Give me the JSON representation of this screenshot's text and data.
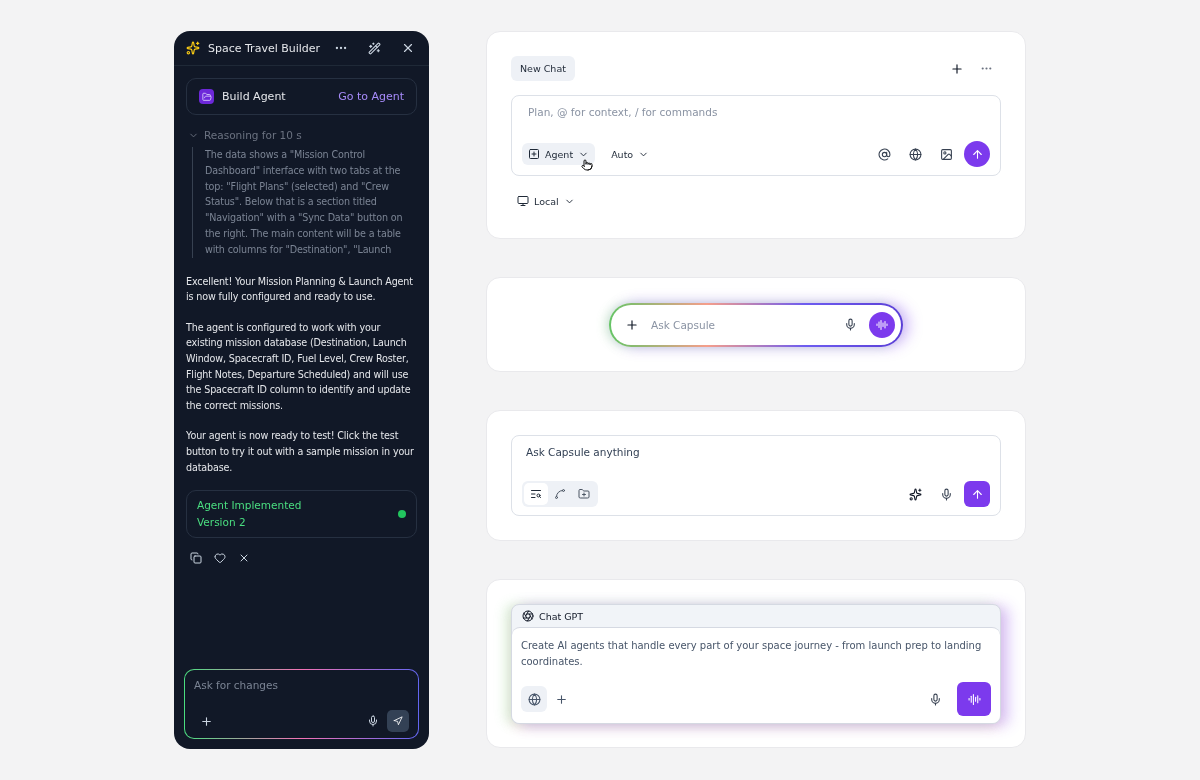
{
  "builder": {
    "title": "Space Travel Builder",
    "agent_card": {
      "label": "Build Agent",
      "link": "Go to Agent"
    },
    "reasoning": {
      "label": "Reasoning for 10 s",
      "expanded": true,
      "text": "The data shows a \"Mission Control Dashboard\" interface with two tabs at the top: \"Flight Plans\" (selected) and \"Crew Status\". Below that is a section titled \"Navigation\" with a \"Sync Data\" button on the right. The main content will be a table with columns for \"Destination\", \"Launch"
    },
    "messages": [
      "Excellent! Your Mission Planning & Launch Agent is now fully configured and ready to use.",
      "The agent is configured to work with your existing mission database (Destination, Launch Window, Spacecraft ID, Fuel Level, Crew Roster, Flight Notes, Departure Scheduled) and will use the Spacecraft ID column to identify and update the correct missions.",
      "Your agent is now ready to test! Click the test button to try it out with a sample mission in your database."
    ],
    "status": {
      "title": "Agent Implemented",
      "version": "Version 2",
      "online": true
    },
    "input": {
      "placeholder": "Ask for changes"
    }
  },
  "new_chat": {
    "tab": "New Chat",
    "input": {
      "placeholder": "Plan, @ for context, / for commands"
    },
    "mode": "Agent",
    "model": "Auto",
    "location": "Local"
  },
  "capsule_pill": {
    "placeholder": "Ask Capsule"
  },
  "capsule_box": {
    "placeholder": "Ask Capsule anything",
    "tools": [
      {
        "kind": "search",
        "selected": true
      },
      {
        "kind": "branch",
        "selected": false
      },
      {
        "kind": "folder",
        "selected": false
      }
    ]
  },
  "chatgpt": {
    "model": "Chat GPT",
    "value": "Create AI agents that handle every part of your space journey - from launch prep to landing coordinates.",
    "web_search": true
  }
}
